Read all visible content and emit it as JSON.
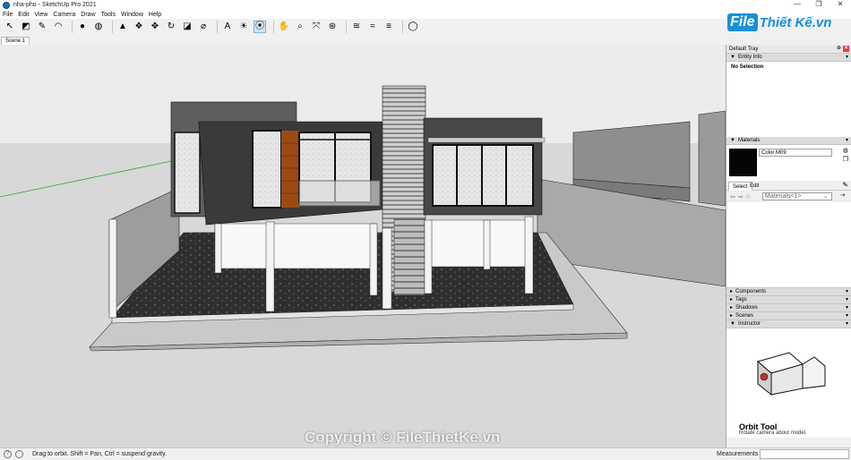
{
  "window": {
    "title": "nha-pho - SketchUp Pro 2021",
    "controls": [
      "—",
      "❐",
      "✕"
    ]
  },
  "menu": [
    "File",
    "Edit",
    "View",
    "Camera",
    "Draw",
    "Tools",
    "Window",
    "Help"
  ],
  "toolbar": [
    {
      "icon": "select-arrow-icon",
      "glyph": "↖"
    },
    {
      "icon": "eraser-icon",
      "glyph": "◩"
    },
    {
      "icon": "pencil-line-icon",
      "glyph": "✎"
    },
    {
      "icon": "arc-icon",
      "glyph": "◠"
    },
    {
      "icon": "shape-circle-icon",
      "glyph": "●"
    },
    {
      "icon": "paint-bucket-icon",
      "glyph": "◍"
    },
    {
      "icon": "push-pull-icon",
      "glyph": "▲"
    },
    {
      "icon": "follow-me-icon",
      "glyph": "❖"
    },
    {
      "icon": "move-icon",
      "glyph": "✥"
    },
    {
      "icon": "rotate-icon",
      "glyph": "↻"
    },
    {
      "icon": "scale-icon",
      "glyph": "◪"
    },
    {
      "icon": "tape-measure-icon",
      "glyph": "⌀"
    },
    {
      "icon": "text-icon",
      "glyph": "A"
    },
    {
      "icon": "paint-icon",
      "glyph": "☀"
    },
    {
      "icon": "orbit-icon",
      "glyph": "⦿",
      "active": true
    },
    {
      "icon": "pan-hand-icon",
      "glyph": "✋"
    },
    {
      "icon": "zoom-icon",
      "glyph": "⌕"
    },
    {
      "icon": "zoom-extents-icon",
      "glyph": "⤧"
    },
    {
      "icon": "warehouse-icon",
      "glyph": "⊛"
    },
    {
      "icon": "extension-icon",
      "glyph": "≋"
    },
    {
      "icon": "layout-icon",
      "glyph": "≈"
    },
    {
      "icon": "ruby-icon",
      "glyph": "≡"
    },
    {
      "icon": "account-icon",
      "glyph": "◯"
    }
  ],
  "logo": {
    "part1": "File",
    "part2": "Thiết Kế.vn"
  },
  "scene_tab": "Scene 1",
  "tray": {
    "title": "Default Tray",
    "entity_info": {
      "header": "Entity Info",
      "selection": "No Selection"
    },
    "materials": {
      "header": "Materials",
      "name": "Color M09",
      "swatch_color": "#050505",
      "tab_select": "Select",
      "tab_edit": "Edit",
      "collection": "Materials<1>"
    },
    "collapsed": [
      "Components",
      "Tags",
      "Shadows",
      "Scenes"
    ],
    "instructor": {
      "header": "Instructor",
      "tool": "Orbit Tool",
      "description": "Rotate camera about model."
    }
  },
  "status": {
    "hint": "Drag to orbit. Shift = Pan, Ctrl = suspend gravity.",
    "measurements_label": "Measurements"
  },
  "watermark": "Copyright © FileThietKe.vn",
  "colors": {
    "accent": "#1a8fd6",
    "sky": "#e8e8e8",
    "ground": "#dcdcdc",
    "dark_wall": "#333333",
    "wood": "#9b4a14"
  }
}
